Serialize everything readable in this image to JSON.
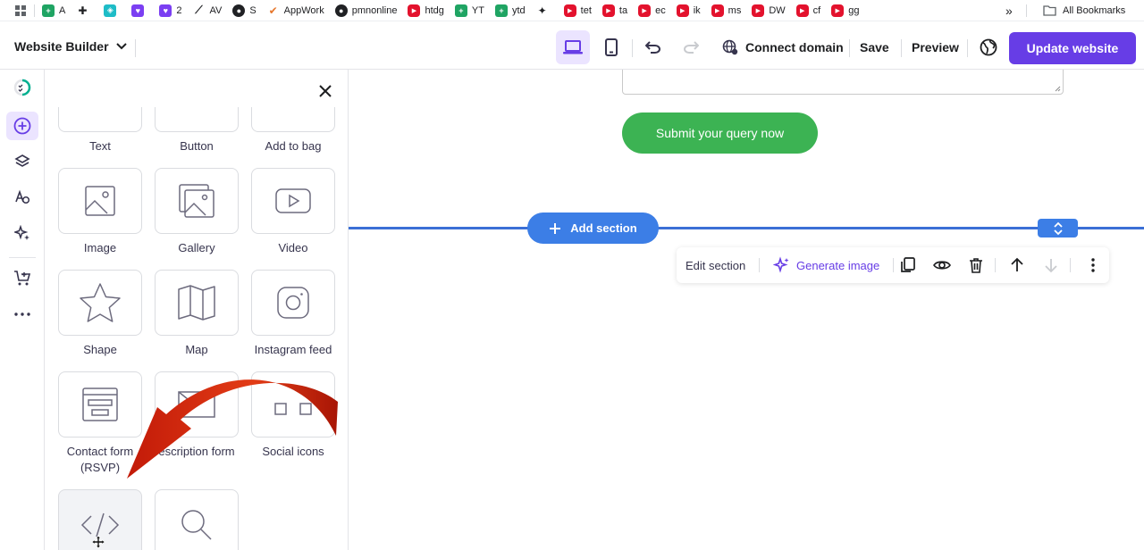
{
  "bookmarks": {
    "items": [
      {
        "label": "A",
        "icon": "plus-square-icon",
        "color": "green"
      },
      {
        "label": "",
        "icon": "puzzle-icon",
        "color": "plain"
      },
      {
        "label": "",
        "icon": "teal-app-icon",
        "color": "teal"
      },
      {
        "label": "",
        "icon": "chat-heart-icon",
        "color": "purple"
      },
      {
        "label": "2",
        "icon": "chat-heart-icon",
        "color": "purple"
      },
      {
        "label": "AV",
        "icon": "trend-icon",
        "color": "plain"
      },
      {
        "label": "S",
        "icon": "globe-icon",
        "color": "black"
      },
      {
        "label": "AppWork",
        "icon": "check-icon",
        "color": "orange"
      },
      {
        "label": "pmnonline",
        "icon": "github-icon",
        "color": "black"
      },
      {
        "label": "htdg",
        "icon": "youtube-icon",
        "color": "red"
      },
      {
        "label": "YT",
        "icon": "plus-square-icon",
        "color": "green"
      },
      {
        "label": "ytd",
        "icon": "plus-square-icon",
        "color": "green"
      },
      {
        "label": "",
        "icon": "pin-icon",
        "color": "plain"
      },
      {
        "label": "tet",
        "icon": "youtube-icon",
        "color": "red"
      },
      {
        "label": "ta",
        "icon": "youtube-icon",
        "color": "red"
      },
      {
        "label": "ec",
        "icon": "youtube-icon",
        "color": "red"
      },
      {
        "label": "ik",
        "icon": "youtube-icon",
        "color": "red"
      },
      {
        "label": "ms",
        "icon": "youtube-icon",
        "color": "red"
      },
      {
        "label": "DW",
        "icon": "youtube-icon",
        "color": "red"
      },
      {
        "label": "cf",
        "icon": "youtube-icon",
        "color": "red"
      },
      {
        "label": "gg",
        "icon": "youtube-icon",
        "color": "red"
      }
    ],
    "overflow": "»",
    "all_bookmarks": "All Bookmarks"
  },
  "topbar": {
    "site_label": "Website Builder",
    "connect_domain": "Connect domain",
    "save": "Save",
    "preview": "Preview",
    "update": "Update website"
  },
  "panel": {
    "tiles": [
      {
        "label": "Text"
      },
      {
        "label": "Button"
      },
      {
        "label": "Add to bag"
      },
      {
        "label": "Image"
      },
      {
        "label": "Gallery"
      },
      {
        "label": "Video"
      },
      {
        "label": "Shape"
      },
      {
        "label": "Map"
      },
      {
        "label": "Instagram feed"
      },
      {
        "label": "Contact form (RSVP)"
      },
      {
        "label": "escription form"
      },
      {
        "label": "Social icons"
      }
    ]
  },
  "canvas": {
    "submit_label": "Submit your query now",
    "add_section": "Add section",
    "toolbar": {
      "edit_section": "Edit section",
      "generate_image": "Generate image"
    }
  },
  "colors": {
    "brand": "#673de6",
    "section_blue": "#3c7ee6",
    "submit_green": "#3cb353",
    "annotation_red": "#d42a0c"
  }
}
